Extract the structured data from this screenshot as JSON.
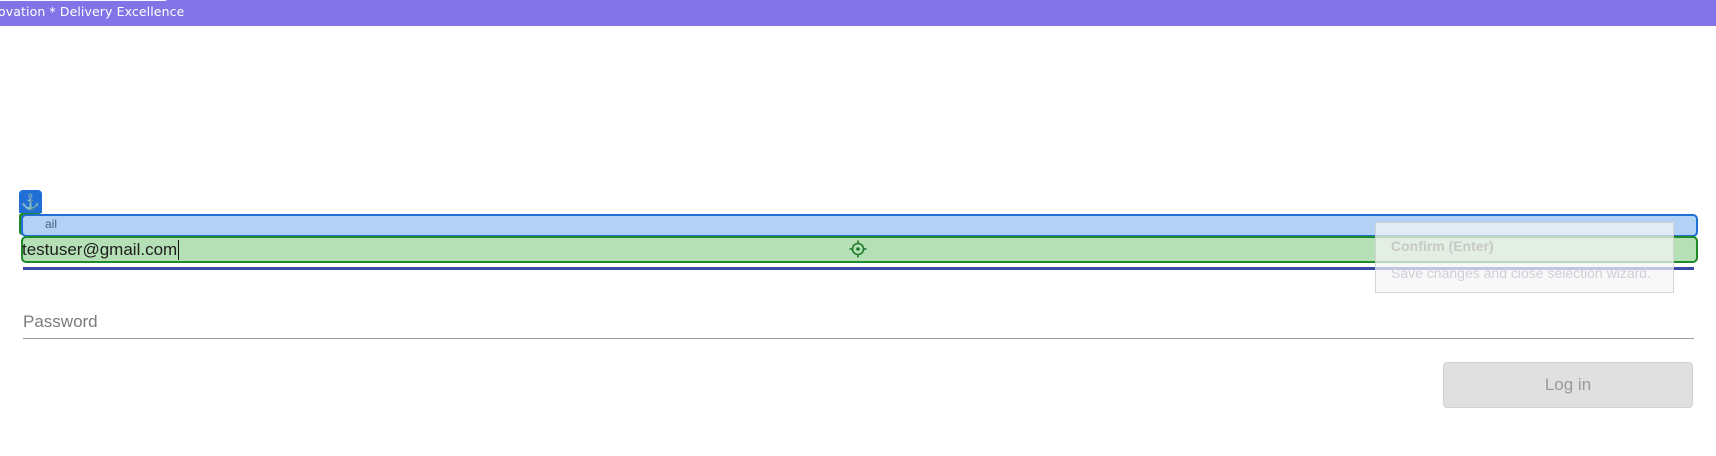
{
  "header": {
    "tagline": "ovation * Delivery Excellence",
    "bar_color": "#8273e6"
  },
  "form": {
    "email": {
      "label": "ail",
      "value": "testuser@gmail.com"
    },
    "password": {
      "label": "Password"
    },
    "login_label": "Log in"
  },
  "selection_wizard": {
    "anchor_badge_icon": "anchor-icon",
    "target_badge_icon": "target-icon",
    "crosshair_icon": "crosshair-icon",
    "label_highlight_color": "#1f6fd6",
    "input_highlight_color": "#1f8a2a"
  },
  "tooltip": {
    "title": "Confirm (Enter)",
    "description": "Save changes and close selection wizard."
  }
}
